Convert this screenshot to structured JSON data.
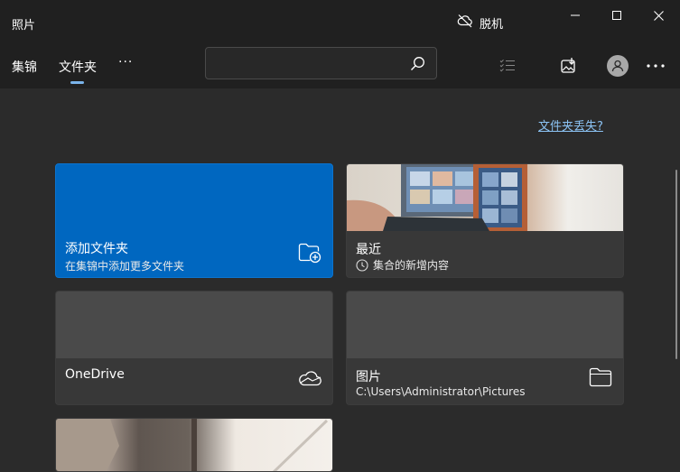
{
  "app": {
    "title": "照片",
    "status": "脱机"
  },
  "nav": {
    "collections": "集锦",
    "folders": "文件夹",
    "more": "···"
  },
  "search": {
    "placeholder": ""
  },
  "link": {
    "missing_folders": "文件夹丢失?"
  },
  "cards": [
    {
      "title": "添加文件夹",
      "subtitle": "在集锦中添加更多文件夹",
      "icon": "add-folder-icon"
    },
    {
      "title": "最近",
      "subtitle": "集合的新增内容",
      "icon": "clock-icon"
    },
    {
      "title": "OneDrive",
      "subtitle": "",
      "icon": "onedrive-cloud-icon"
    },
    {
      "title": "图片",
      "subtitle": "C:\\Users\\Administrator\\Pictures",
      "icon": "folder-icon"
    }
  ],
  "colors": {
    "accent": "#0067c0",
    "link": "#8cc4f5",
    "titlebar": "#202020",
    "background": "#2b2b2b"
  }
}
